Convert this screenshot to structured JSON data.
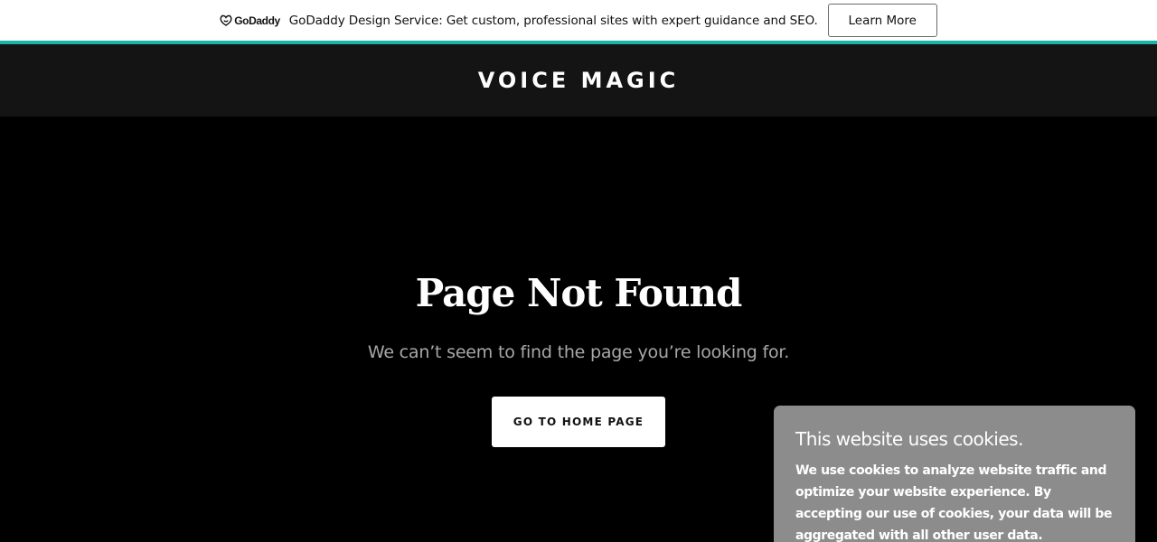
{
  "promo": {
    "brand": "GoDaddy",
    "text": "GoDaddy Design Service: Get custom, professional sites with expert guidance and SEO.",
    "button_label": "Learn More",
    "accent_color": "#1bb4a9",
    "logo_icon": "godaddy-logo-icon"
  },
  "header": {
    "site_title": "VOICE MAGIC",
    "background": "#141414"
  },
  "main": {
    "heading": "Page Not Found",
    "subheading": "We can’t seem to find the page you’re looking for.",
    "home_button_label": "GO TO HOME PAGE"
  },
  "cookie_banner": {
    "title": "This website uses cookies.",
    "body": "We use cookies to analyze website traffic and optimize your website experience. By accepting our use of cookies, your data will be aggregated with all other user data.",
    "background": "#8c8c8c"
  }
}
